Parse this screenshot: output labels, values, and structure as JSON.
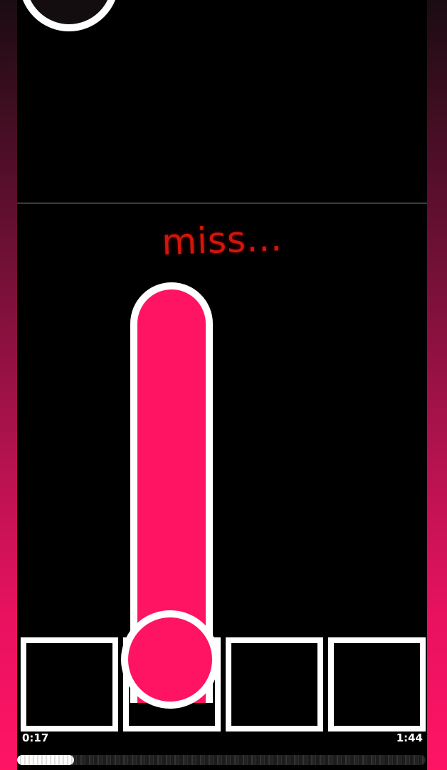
{
  "game": {
    "judgement": "miss...",
    "lanes": 4,
    "hold_note_lane": 2
  },
  "playback": {
    "current_time": "0:17",
    "total_time": "1:44",
    "progress_fraction": 0.14
  },
  "colors": {
    "note": "#ff1464",
    "judgement_miss": "#d2160a",
    "key_border": "#ffffff",
    "background": "#000000"
  }
}
